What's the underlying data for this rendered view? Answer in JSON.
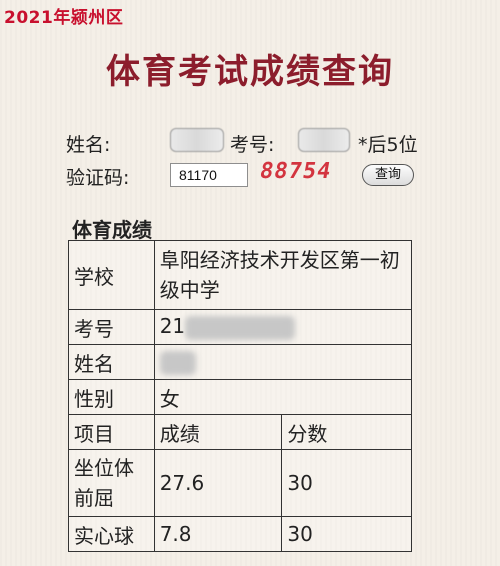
{
  "corner_label": "2021年颍州区",
  "title": "体育考试成绩查询",
  "form": {
    "name_label": "姓名:",
    "exam_no_label": "考号:",
    "exam_no_hint": "*后5位",
    "captcha_label": "验证码:",
    "captcha_input_value": "81170",
    "captcha_image_text": "88754",
    "query_button": "查询"
  },
  "section_title": "体育成绩",
  "table": {
    "school_label": "学校",
    "school_value": "阜阳经济技术开发区第一初级中学",
    "exam_no_label": "考号",
    "exam_no_value": "21",
    "name_label": "姓名",
    "gender_label": "性别",
    "gender_value": "女",
    "header": {
      "item": "项目",
      "score": "成绩",
      "points": "分数"
    },
    "rows": [
      {
        "item": "坐位体前屈",
        "score": "27.6",
        "points": "30"
      },
      {
        "item": "实心球",
        "score": "7.8",
        "points": "30"
      }
    ]
  }
}
